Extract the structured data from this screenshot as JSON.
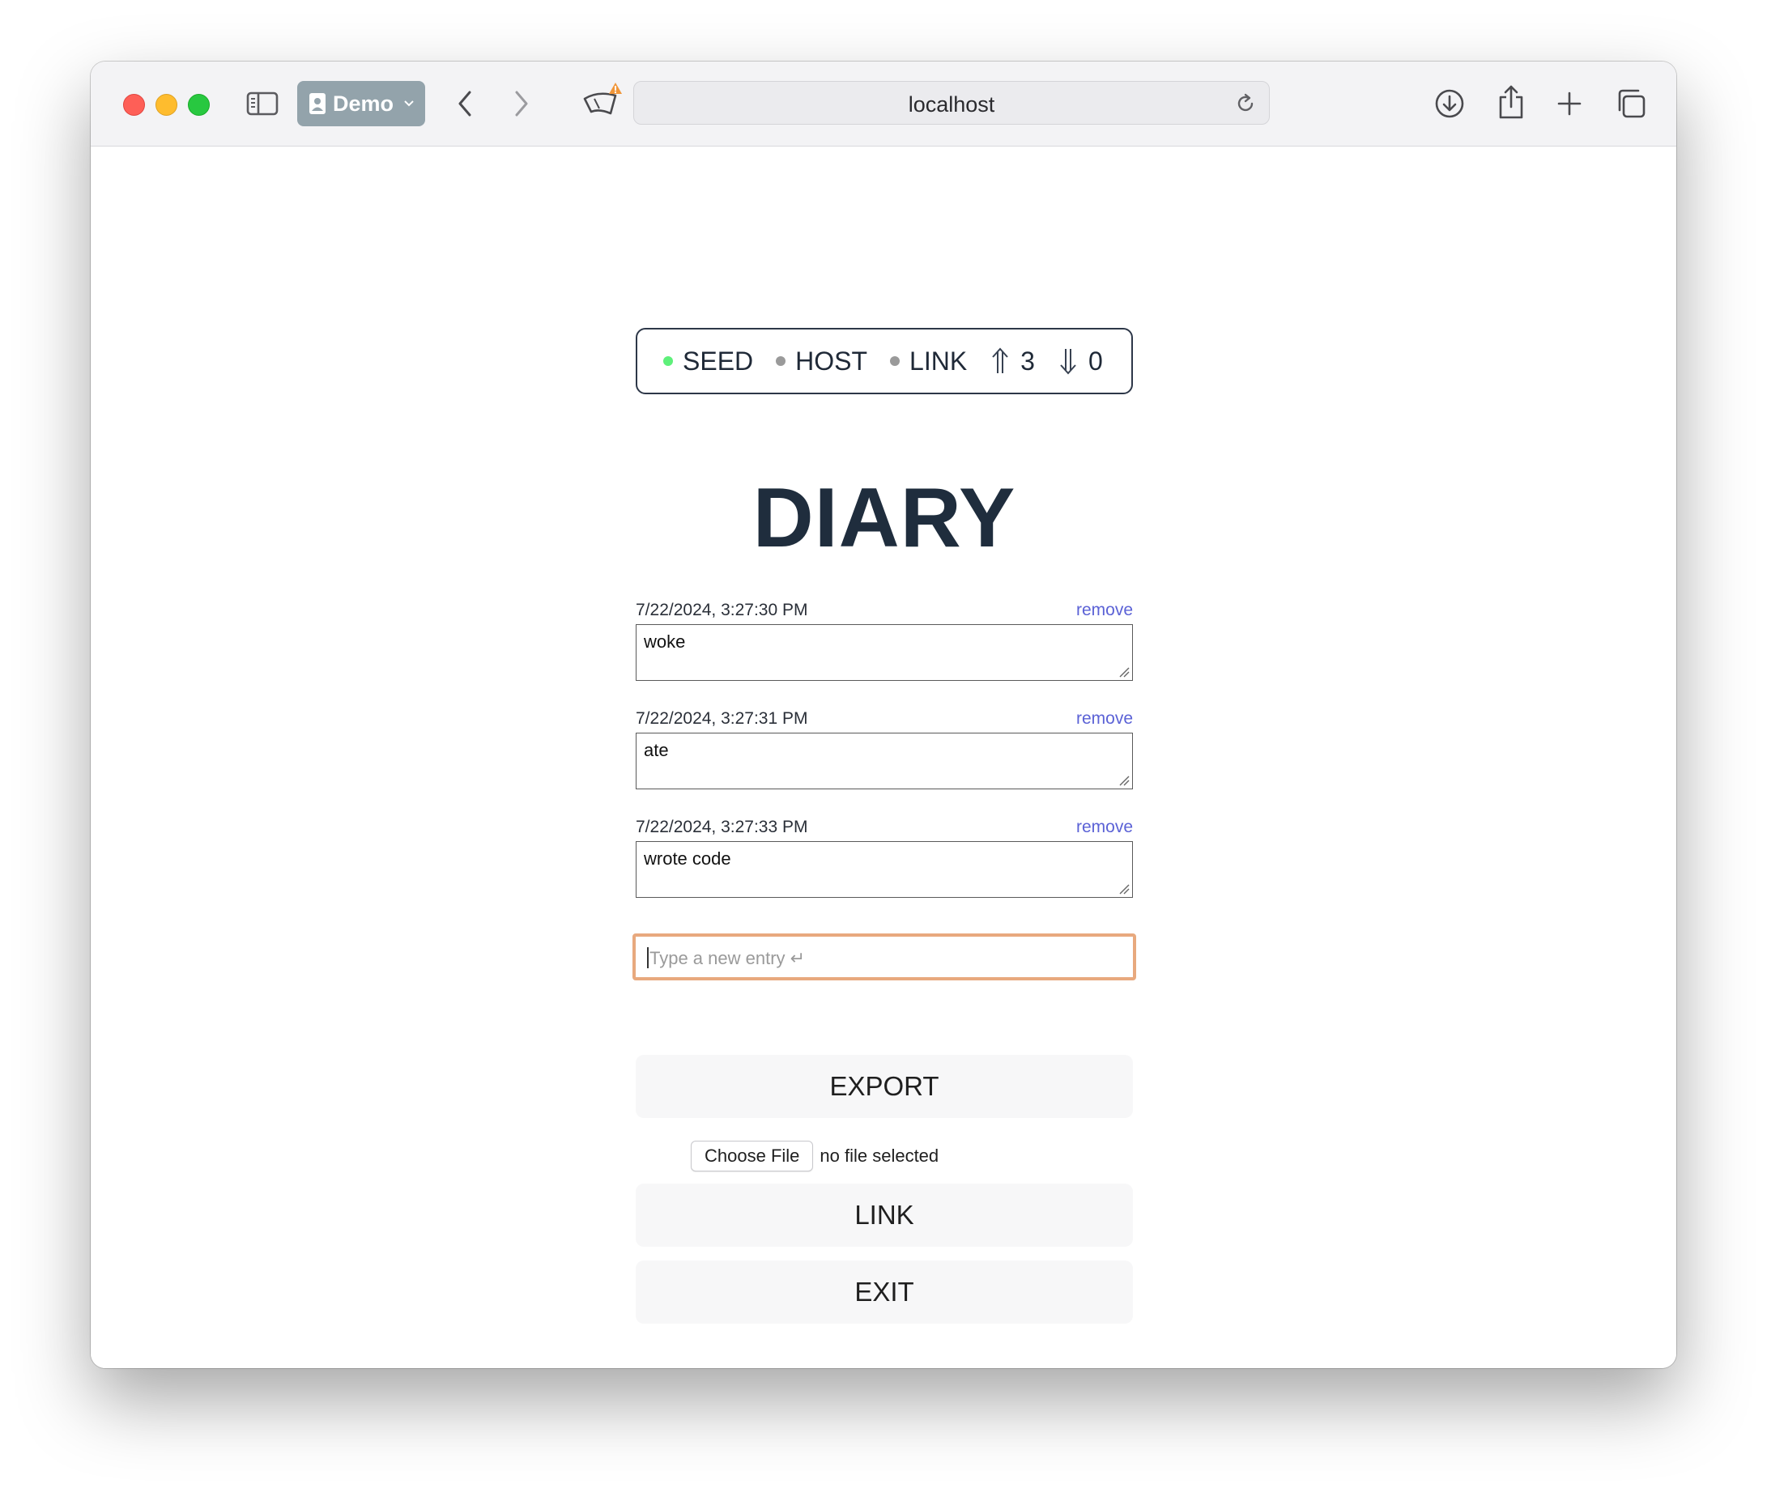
{
  "browser": {
    "profile_label": "Demo",
    "address": "localhost"
  },
  "status": {
    "seed_label": "SEED",
    "host_label": "HOST",
    "link_label": "LINK",
    "up_count": "3",
    "down_count": "0",
    "seed_color": "#5ef07a",
    "inactive_color": "#9a9a9a"
  },
  "title": "DIARY",
  "entries": [
    {
      "date": "7/22/2024, 3:27:30 PM",
      "text": "woke",
      "remove_label": "remove"
    },
    {
      "date": "7/22/2024, 3:27:31 PM",
      "text": "ate",
      "remove_label": "remove"
    },
    {
      "date": "7/22/2024, 3:27:33 PM",
      "text": "wrote code",
      "remove_label": "remove"
    }
  ],
  "new_entry": {
    "placeholder": "Type a new entry ↵",
    "focus_color": "#e8a97e"
  },
  "actions": {
    "export_label": "EXPORT",
    "choose_file_label": "Choose File",
    "file_status": "no file selected",
    "link_label": "LINK",
    "exit_label": "EXIT"
  },
  "icons": {
    "sidebar": "sidebar-icon",
    "profile": "person-badge-icon",
    "back": "chevron-left-icon",
    "forward": "chevron-right-icon",
    "privacy": "privacy-report-icon",
    "reload": "reload-icon",
    "download": "download-icon",
    "share": "share-icon",
    "new_tab": "plus-icon",
    "tabs": "tab-overview-icon"
  },
  "colors": {
    "link_accent": "#5b62d6",
    "title": "#1f2d3d",
    "profile_pill": "#93a3ab"
  }
}
